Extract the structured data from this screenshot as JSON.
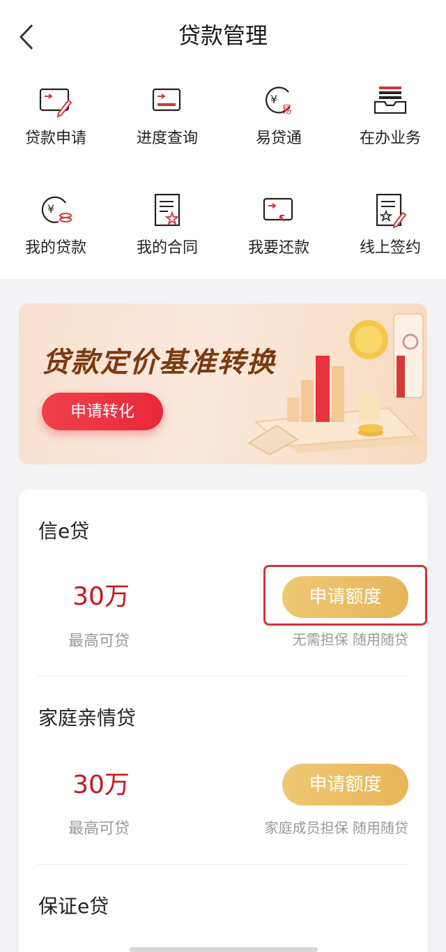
{
  "header": {
    "title": "贷款管理"
  },
  "grid": [
    {
      "label": "贷款申请",
      "icon": "loan-apply-icon"
    },
    {
      "label": "进度查询",
      "icon": "progress-query-icon"
    },
    {
      "label": "易贷通",
      "icon": "yidaitong-icon"
    },
    {
      "label": "在办业务",
      "icon": "in-progress-business-icon"
    },
    {
      "label": "我的贷款",
      "icon": "my-loan-icon"
    },
    {
      "label": "我的合同",
      "icon": "my-contract-icon"
    },
    {
      "label": "我要还款",
      "icon": "repayment-icon"
    },
    {
      "label": "线上签约",
      "icon": "online-sign-icon"
    }
  ],
  "banner": {
    "title": "贷款定价基准转换",
    "button": "申请转化"
  },
  "products": [
    {
      "name": "信e贷",
      "amount": "30万",
      "amount_label": "最高可贷",
      "button": "申请额度",
      "feature": "无需担保 随用随贷"
    },
    {
      "name": "家庭亲情贷",
      "amount": "30万",
      "amount_label": "最高可贷",
      "button": "申请额度",
      "feature": "家庭成员担保 随用随贷"
    },
    {
      "name": "保证e贷"
    }
  ],
  "colors": {
    "accent_red": "#c8161d",
    "gold": "#e7b55a",
    "banner_text": "#7a3a12"
  }
}
